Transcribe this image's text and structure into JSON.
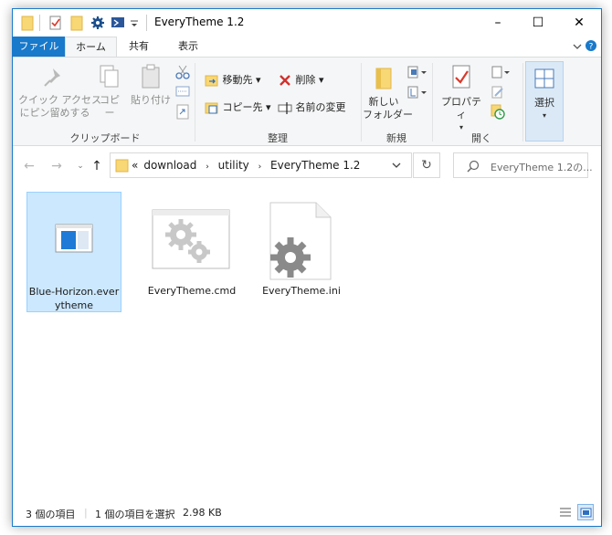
{
  "window": {
    "title": "EveryTheme 1.2",
    "controls": {
      "minimize": "–",
      "maximize": "☐",
      "close": "✕"
    }
  },
  "ribbon_tabs": [
    "ファイル",
    "ホーム",
    "共有",
    "表示"
  ],
  "ribbon": {
    "clipboard": {
      "pin_label": "クイック アクセス\nにピン留めする",
      "copy_label": "コピー",
      "paste_label": "貼り付け",
      "group_label": "クリップボード"
    },
    "organize": {
      "move_to": "移動先",
      "copy_to": "コピー先",
      "delete": "削除",
      "rename": "名前の変更",
      "group_label": "整理"
    },
    "new": {
      "new_folder": "新しい\nフォルダー",
      "group_label": "新規"
    },
    "open": {
      "properties": "プロパティ",
      "group_label": "開く"
    },
    "select": {
      "select_label": "選択"
    }
  },
  "address": {
    "prefix": "«",
    "path": [
      "download",
      "utility",
      "EveryTheme 1.2"
    ],
    "search_placeholder": "EveryTheme 1.2の..."
  },
  "files": [
    {
      "name": "Blue-Horizon.everytheme",
      "icon": "theme-window-icon",
      "selected": true
    },
    {
      "name": "EveryTheme.cmd",
      "icon": "cmd-gears-icon",
      "selected": false
    },
    {
      "name": "EveryTheme.ini",
      "icon": "ini-gear-icon",
      "selected": false
    }
  ],
  "status": {
    "count": "3 個の項目",
    "selection": "1 個の項目を選択",
    "size": "2.98 KB"
  },
  "colors": {
    "accent": "#1979ca",
    "selected_bg": "#cce8ff",
    "selected_border": "#99d1ff",
    "folder_yellow": "#f8d775"
  }
}
